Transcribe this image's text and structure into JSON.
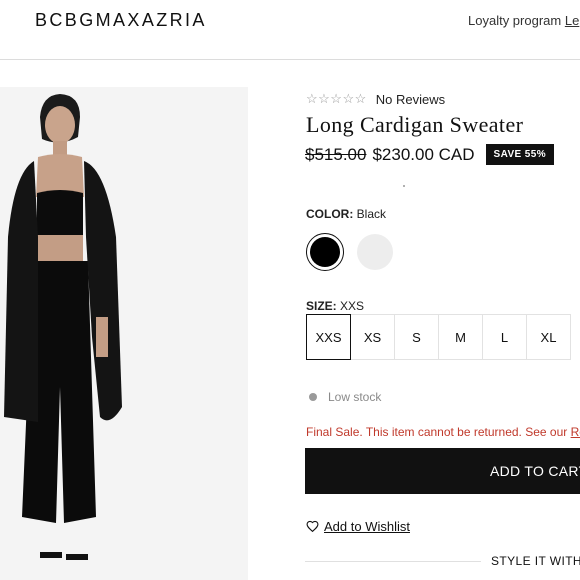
{
  "header": {
    "logo": "BCBGMAXAZRIA",
    "loyalty": "Loyalty program",
    "loyalty_link": "Le"
  },
  "product": {
    "rating_stars": "☆☆☆☆☆",
    "reviews": "No Reviews",
    "title": "Long Cardigan Sweater",
    "old_price": "$515.00",
    "new_price": "$230.00 CAD",
    "save_badge": "SAVE 55%",
    "color_label": "COLOR:",
    "color_value": "Black",
    "colors": [
      "black",
      "white"
    ],
    "size_label": "SIZE:",
    "size_value": "XXS",
    "sizes": [
      "XXS",
      "XS",
      "S",
      "M",
      "L",
      "XL"
    ],
    "stock": "Low stock",
    "final_sale": "Final Sale. This item cannot be returned. See our ",
    "final_sale_link": "Re",
    "add_to_cart": "ADD TO CART",
    "wishlist": "Add to Wishlist",
    "style_it": "STYLE IT WITH"
  },
  "colors": {
    "accent": "#111111",
    "sale_text": "#c0392b",
    "muted": "#9a9a9a"
  }
}
